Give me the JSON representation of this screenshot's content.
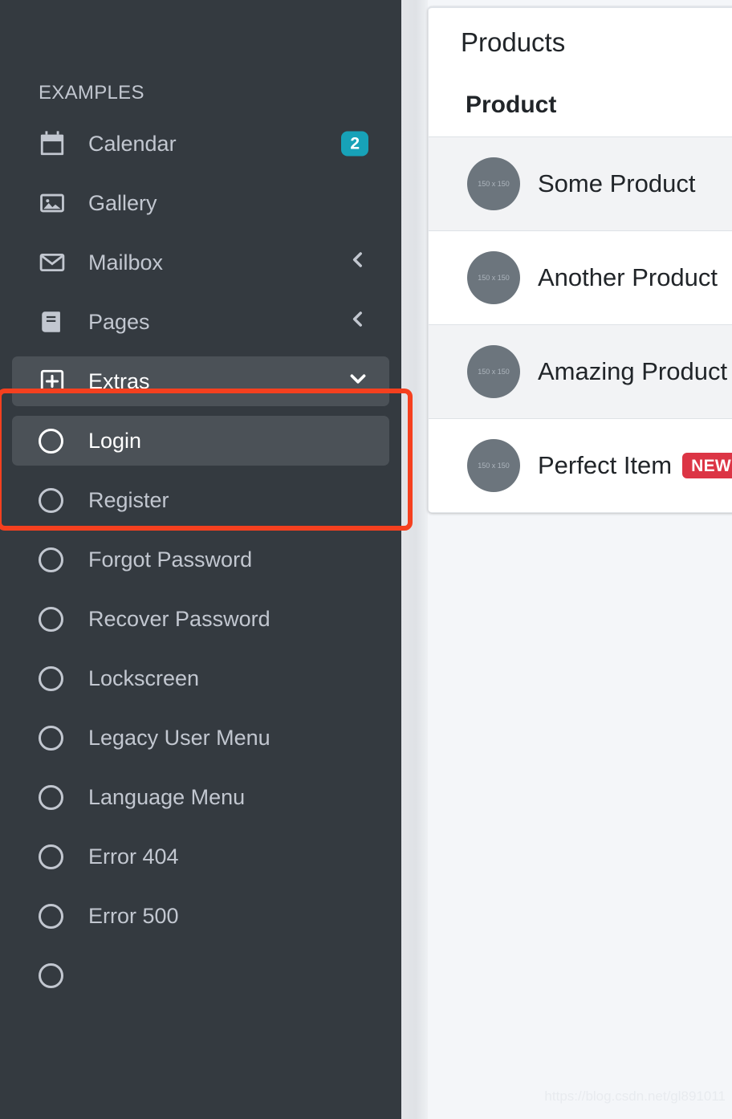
{
  "sidebar": {
    "section_title": "EXAMPLES",
    "items": [
      {
        "label": "Calendar",
        "icon": "calendar-icon",
        "badge": "2",
        "badge_color": "#17a2b8",
        "state": "normal",
        "level": "top"
      },
      {
        "label": "Gallery",
        "icon": "image-icon",
        "state": "normal",
        "level": "top"
      },
      {
        "label": "Mailbox",
        "icon": "envelope-icon",
        "chevron": "chevron-left-icon",
        "state": "normal",
        "level": "top"
      },
      {
        "label": "Pages",
        "icon": "book-icon",
        "chevron": "chevron-left-icon",
        "state": "normal",
        "level": "top"
      },
      {
        "label": "Extras",
        "icon": "plus-square-icon",
        "chevron": "chevron-down-icon",
        "state": "active",
        "level": "top"
      },
      {
        "label": "Login",
        "icon": "circle-icon",
        "state": "active",
        "level": "sub"
      },
      {
        "label": "Register",
        "icon": "circle-icon",
        "state": "normal",
        "level": "sub"
      },
      {
        "label": "Forgot Password",
        "icon": "circle-icon",
        "state": "normal",
        "level": "sub"
      },
      {
        "label": "Recover Password",
        "icon": "circle-icon",
        "state": "normal",
        "level": "sub"
      },
      {
        "label": "Lockscreen",
        "icon": "circle-icon",
        "state": "normal",
        "level": "sub"
      },
      {
        "label": "Legacy User Menu",
        "icon": "circle-icon",
        "state": "normal",
        "level": "sub"
      },
      {
        "label": "Language Menu",
        "icon": "circle-icon",
        "state": "normal",
        "level": "sub"
      },
      {
        "label": "Error 404",
        "icon": "circle-icon",
        "state": "normal",
        "level": "sub"
      },
      {
        "label": "Error 500",
        "icon": "circle-icon",
        "state": "normal",
        "level": "sub"
      },
      {
        "label": "",
        "icon": "circle-icon",
        "state": "normal",
        "level": "sub"
      }
    ]
  },
  "content": {
    "card_title": "Products",
    "column_header": "Product",
    "products": [
      {
        "name": "Some Product",
        "thumb_label": "150 x 150",
        "badge": ""
      },
      {
        "name": "Another Product",
        "thumb_label": "150 x 150",
        "badge": ""
      },
      {
        "name": "Amazing Product",
        "thumb_label": "150 x 150",
        "badge": ""
      },
      {
        "name": "Perfect Item",
        "thumb_label": "150 x 150",
        "badge": "NEW"
      }
    ]
  },
  "annotation": {
    "name": "highlight-box",
    "color": "#f5401f",
    "targets": [
      "Extras",
      "Login"
    ]
  },
  "watermark": {
    "text": "https://blog.csdn.net/gl891011"
  },
  "colors": {
    "sidebar_bg": "#343a40",
    "sidebar_active_bg": "#4b5157",
    "sidebar_text": "#c2c7d0",
    "page_bg": "#f4f6f9",
    "badge_info": "#17a2b8",
    "badge_danger": "#dc3545",
    "annotation": "#f5401f"
  }
}
